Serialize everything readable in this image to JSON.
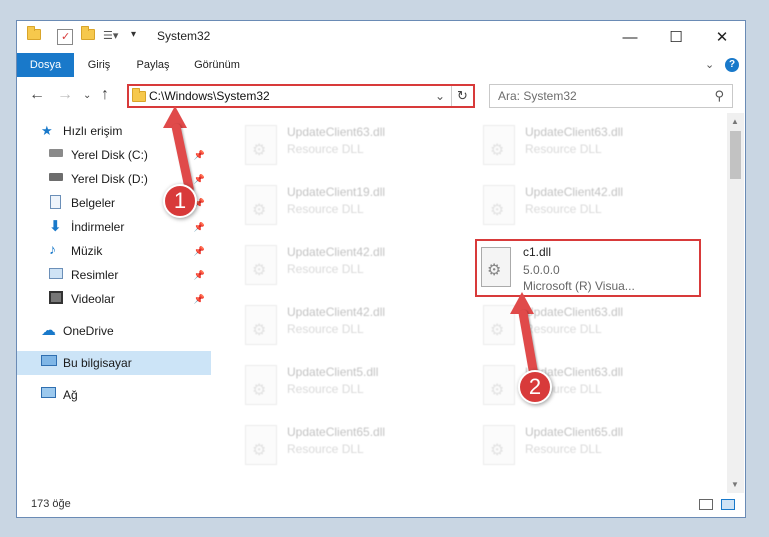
{
  "window": {
    "title": "System32"
  },
  "ribbon": {
    "tabs": [
      {
        "label": "Dosya"
      },
      {
        "label": "Giriş"
      },
      {
        "label": "Paylaş"
      },
      {
        "label": "Görünüm"
      }
    ]
  },
  "address": {
    "path": "C:\\Windows\\System32"
  },
  "search": {
    "placeholder": "Ara: System32"
  },
  "sidebar": {
    "items": [
      {
        "label": "Hızlı erişim"
      },
      {
        "label": "Yerel Disk (C:)"
      },
      {
        "label": "Yerel Disk (D:)"
      },
      {
        "label": "Belgeler"
      },
      {
        "label": "İndirmeler"
      },
      {
        "label": "Müzik"
      },
      {
        "label": "Resimler"
      },
      {
        "label": "Videolar"
      },
      {
        "label": "OneDrive"
      },
      {
        "label": "Bu bilgisayar"
      },
      {
        "label": "Ağ"
      }
    ]
  },
  "files": {
    "left": [
      {
        "name": "UpdateClient63.dll",
        "type": "Resource DLL"
      },
      {
        "name": "UpdateClient19.dll",
        "type": "Resource DLL"
      },
      {
        "name": "UpdateClient42.dll",
        "type": "Resource DLL"
      },
      {
        "name": "UpdateClient42.dll",
        "type": "Resource DLL"
      },
      {
        "name": "UpdateClient5.dll",
        "type": "Resource DLL"
      },
      {
        "name": "UpdateClient65.dll",
        "type": "Resource DLL"
      }
    ],
    "right": [
      {
        "name": "UpdateClient63.dll",
        "type": "Resource DLL"
      },
      {
        "name": "UpdateClient42.dll",
        "type": "Resource DLL"
      },
      {
        "name": "UpdateClient63.dll",
        "type": "Resource DLL"
      },
      {
        "name": "UpdateClient63.dll",
        "type": "Resource DLL"
      },
      {
        "name": "UpdateClient65.dll",
        "type": "Resource DLL"
      }
    ],
    "highlighted": {
      "name": "c1.dll",
      "version": "5.0.0.0",
      "company": "Microsoft (R) Visua..."
    }
  },
  "status": {
    "count": "173 öğe"
  },
  "annotations": {
    "step1": "1",
    "step2": "2"
  },
  "colors": {
    "accent": "#1979ca",
    "highlight": "#d83a3a",
    "selected": "#cce4f7"
  }
}
